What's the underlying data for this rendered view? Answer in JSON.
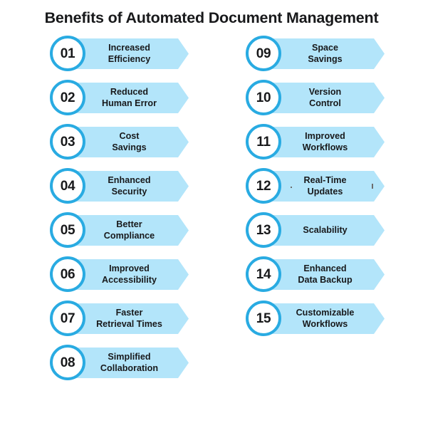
{
  "title": "Benefits of Automated Document Management",
  "colors": {
    "banner_fill": "#b3e5fa",
    "ring": "#29abe2",
    "text": "#18191b",
    "background": "#ffffff"
  },
  "columns": {
    "left": [
      {
        "number": "01",
        "line1": "Increased",
        "line2": "Efficiency"
      },
      {
        "number": "02",
        "line1": "Reduced",
        "line2": "Human Error"
      },
      {
        "number": "03",
        "line1": "Cost",
        "line2": "Savings"
      },
      {
        "number": "04",
        "line1": "Enhanced",
        "line2": "Security"
      },
      {
        "number": "05",
        "line1": "Better",
        "line2": "Compliance"
      },
      {
        "number": "06",
        "line1": "Improved",
        "line2": "Accessibility"
      },
      {
        "number": "07",
        "line1": "Faster",
        "line2": "Retrieval Times"
      },
      {
        "number": "08",
        "line1": "Simplified",
        "line2": "Collaboration"
      }
    ],
    "right": [
      {
        "number": "09",
        "line1": "Space",
        "line2": "Savings"
      },
      {
        "number": "10",
        "line1": "Version",
        "line2": "Control"
      },
      {
        "number": "11",
        "line1": "Improved",
        "line2": "Workflows"
      },
      {
        "number": "12",
        "line1": "Real-Time",
        "line2": "Updates"
      },
      {
        "number": "13",
        "line1": "Scalability",
        "line2": ""
      },
      {
        "number": "14",
        "line1": "Enhanced",
        "line2": "Data Backup"
      },
      {
        "number": "15",
        "line1": "Customizable",
        "line2": "Workflows"
      }
    ]
  }
}
